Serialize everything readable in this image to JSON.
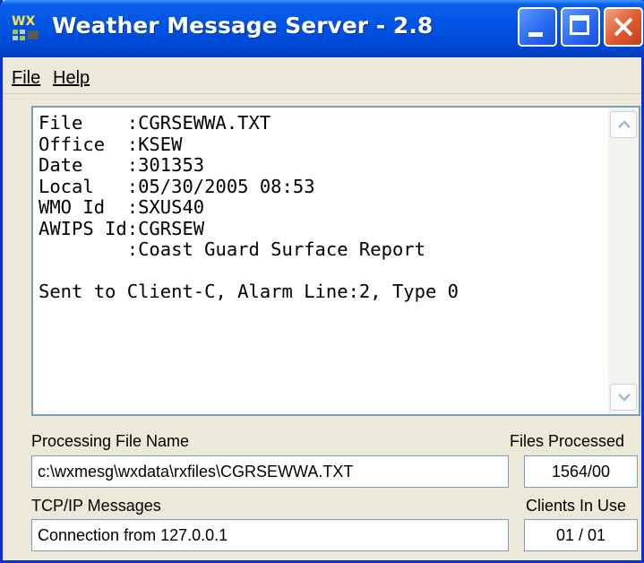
{
  "window": {
    "title": "Weather Message Server - 2.8",
    "icon_text": "WX"
  },
  "menu": {
    "file": "File",
    "help": "Help"
  },
  "message_text": "File    :CGRSEWWA.TXT\nOffice  :KSEW\nDate    :301353\nLocal   :05/30/2005 08:53\nWMO Id  :SXUS40\nAWIPS Id:CGRSEW\n        :Coast Guard Surface Report\n\nSent to Client-C, Alarm Line:2, Type 0",
  "processing": {
    "label": "Processing File Name",
    "value": "c:\\wxmesg\\wxdata\\rxfiles\\CGRSEWWA.TXT"
  },
  "files_processed": {
    "label": "Files Processed",
    "value": "1564/00"
  },
  "tcpip": {
    "label": "TCP/IP Messages",
    "value": "Connection from 127.0.0.1"
  },
  "clients": {
    "label": "Clients In Use",
    "value": "01 / 01"
  },
  "icons": [
    "app-icon",
    "minimize-icon",
    "maximize-icon",
    "close-icon",
    "scroll-up-icon",
    "scroll-down-icon"
  ],
  "colors": {
    "titlebar": "#0055E5",
    "window_bg": "#ECE9D8",
    "close_button": "#E0582D"
  }
}
